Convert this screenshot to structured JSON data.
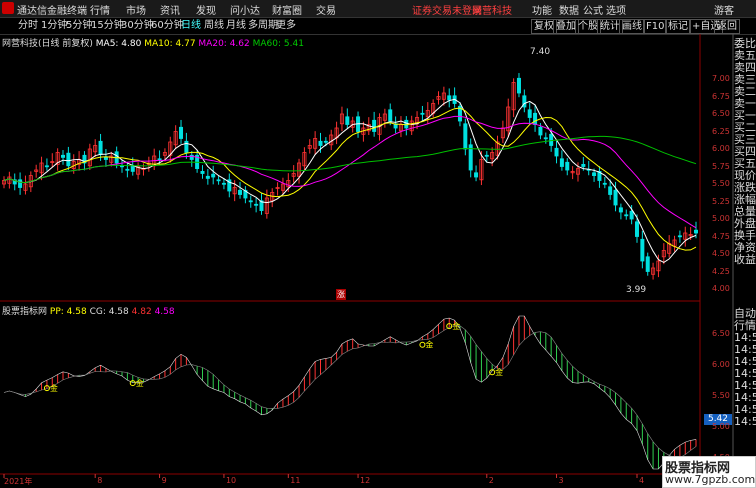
{
  "app": {
    "name": "通达信金融终端"
  },
  "menu": [
    "行情",
    "市场",
    "资讯",
    "发现",
    "问小达",
    "财富圈",
    "交易"
  ],
  "title_right": {
    "notice": "证券交易未登录",
    "broker": "网营科技",
    "items": [
      "功能",
      "数据",
      "公式",
      "选项"
    ],
    "guest": "游客"
  },
  "periods": [
    "分时",
    "1分钟",
    "5分钟",
    "15分钟",
    "30分钟",
    "60分钟",
    "日线",
    "周线",
    "月线",
    "多周期",
    "更多"
  ],
  "active_period": "日线",
  "right_toolbar": [
    "复权",
    "叠加",
    "个股",
    "统计",
    "画线",
    "F10",
    "标记",
    "+自选",
    "返回"
  ],
  "main_panel": {
    "stock": "网营科技(日线 前复权)",
    "ma5": "MA5: 4.80",
    "ma10": "MA10: 4.77",
    "ma20": "MA20: 4.62",
    "ma60": "MA60: 5.41",
    "high_label": "7.40",
    "low_label": "3.99",
    "zhang": "涨"
  },
  "sub_panel": {
    "name": "股票指标网",
    "pp": "PP: 4.58",
    "cg": "CG: 4.58",
    "v1": "4.82",
    "v2": "4.58",
    "gold": "金",
    "current": "5.42"
  },
  "axis_main": [
    "7.00",
    "6.75",
    "6.50",
    "6.25",
    "6.00",
    "5.75",
    "5.50",
    "5.25",
    "5.00",
    "4.75",
    "4.50",
    "4.25",
    "4.00"
  ],
  "axis_sub": [
    "6.50",
    "6.00",
    "5.50",
    "5.00",
    "4.50"
  ],
  "xlabels": [
    "2021年",
    "8",
    "9",
    "10",
    "11",
    "12",
    "2",
    "3",
    "4"
  ],
  "right_panel": [
    "委比",
    "卖五",
    "卖四",
    "卖三",
    "卖二",
    "卖一",
    "买一",
    "买二",
    "买三",
    "买四",
    "买五",
    "现价",
    "涨跌",
    "涨幅",
    "总量",
    "外盘",
    "换手",
    "净资",
    "收益"
  ],
  "right_panel2": [
    "自动",
    "行情",
    "14:5",
    "14:5",
    "14:5",
    "14:5",
    "14:5",
    "14:5",
    "14:5",
    "14:5"
  ],
  "watermark": {
    "line1": "股票指标网",
    "line2": "www.7gpzb.com"
  },
  "colors": {
    "up": "#ff3232",
    "down": "#00e0e0",
    "ma5": "#ffffff",
    "ma10": "#ffff00",
    "ma20": "#ff00ff",
    "ma60": "#00c000"
  },
  "chart_data": {
    "type": "candlestick",
    "closes": [
      5.55,
      5.6,
      5.5,
      5.45,
      5.5,
      5.62,
      5.7,
      5.8,
      5.75,
      5.82,
      5.95,
      5.88,
      5.76,
      5.82,
      5.85,
      5.8,
      6.0,
      6.05,
      5.92,
      5.85,
      5.9,
      5.8,
      5.75,
      5.7,
      5.68,
      5.75,
      5.72,
      5.8,
      5.9,
      5.85,
      5.95,
      6.1,
      6.25,
      6.15,
      5.95,
      5.85,
      5.72,
      5.65,
      5.58,
      5.6,
      5.55,
      5.5,
      5.4,
      5.45,
      5.35,
      5.3,
      5.25,
      5.2,
      5.12,
      5.3,
      5.38,
      5.45,
      5.5,
      5.55,
      5.65,
      5.8,
      5.95,
      6.05,
      6.15,
      6.05,
      6.1,
      6.2,
      6.3,
      6.5,
      6.35,
      6.4,
      6.25,
      6.3,
      6.35,
      6.25,
      6.45,
      6.5,
      6.4,
      6.3,
      6.35,
      6.3,
      6.4,
      6.45,
      6.5,
      6.55,
      6.65,
      6.75,
      6.8,
      6.7,
      6.65,
      6.4,
      6.0,
      5.7,
      5.6,
      5.85,
      5.9,
      5.95,
      6.1,
      6.3,
      6.6,
      6.95,
      6.8,
      6.6,
      6.45,
      6.35,
      6.2,
      6.15,
      6.05,
      5.9,
      5.75,
      5.7,
      5.68,
      5.72,
      5.75,
      5.7,
      5.62,
      5.55,
      5.5,
      5.35,
      5.2,
      5.1,
      5.05,
      5.0,
      4.75,
      4.4,
      4.25,
      4.3,
      4.4,
      4.55,
      4.65,
      4.7,
      4.75,
      4.8,
      4.78,
      4.8
    ]
  }
}
